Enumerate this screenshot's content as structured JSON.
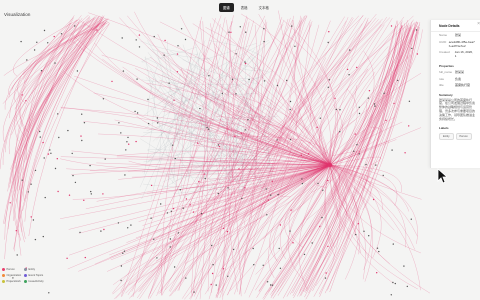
{
  "app": {
    "title": "Visualization"
  },
  "tabs": [
    {
      "label": "图谱",
      "active": true
    },
    {
      "label": "表格",
      "active": false
    },
    {
      "label": "文本格",
      "active": false
    }
  ],
  "details": {
    "header": "Node Details",
    "rows": [
      {
        "key": "Name",
        "value": "张某"
      },
      {
        "key": "UUID",
        "value": "ace2d8b-4f5e-bea7b-ad7f1e7e2"
      },
      {
        "key": "Created",
        "value": "Jan 16, 2026, 1"
      }
    ],
    "properties_title": "Properties",
    "properties": [
      {
        "key": "full_name",
        "value": "张某某"
      },
      {
        "key": "role",
        "value": "负责"
      },
      {
        "key": "title",
        "value": "首席执行官"
      }
    ],
    "summary_title": "Summary",
    "summary": "张某某是公司的首席执行官，在公司发展过程中负责整体的战略规划与运营管理，曾多次参与重要项目的决策工作，领导团队推进业务持续增长。",
    "labels_title": "Labels",
    "labels": [
      "Entity",
      "Person"
    ]
  },
  "legend": [
    {
      "label": "Person",
      "color": "#e83e6b"
    },
    {
      "label": "Entity",
      "color": "#8a8fa0"
    },
    {
      "label": "Organization",
      "color": "#f08a3a"
    },
    {
      "label": "Event Topics",
      "color": "#6f5bd6"
    },
    {
      "label": "Project/work",
      "color": "#c9c23a"
    },
    {
      "label": "Issue/Activity",
      "color": "#3ea35d"
    }
  ],
  "colors": {
    "edge": "#e0346b",
    "edge_gray": "#9aa0aa",
    "node": "#4a4a4a"
  }
}
